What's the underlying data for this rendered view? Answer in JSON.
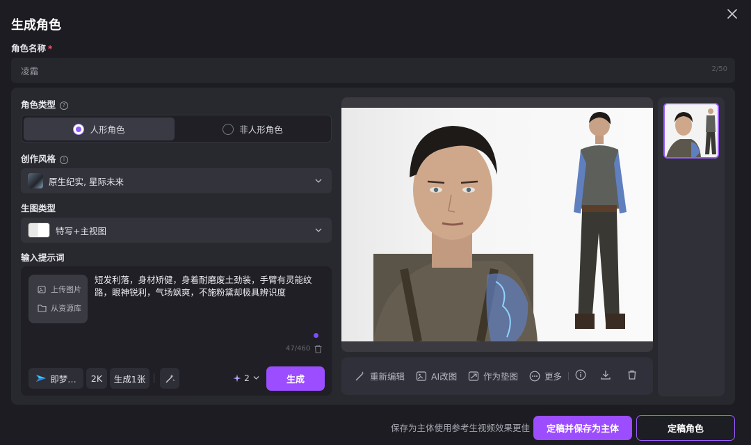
{
  "dialog": {
    "title": "生成角色",
    "close_icon": "close-icon"
  },
  "name_field": {
    "label": "角色名称",
    "required_mark": "*",
    "value": "凌霜",
    "counter": "2/50"
  },
  "character_type": {
    "label": "角色类型",
    "options": [
      {
        "label": "人形角色",
        "selected": true
      },
      {
        "label": "非人形角色",
        "selected": false
      }
    ]
  },
  "style": {
    "label": "创作风格",
    "value": "原生纪实, 星际未来"
  },
  "image_type": {
    "label": "生图类型",
    "value": "特写+主视图"
  },
  "prompt": {
    "label": "输入提示词",
    "upload_image": "上传图片",
    "from_library": "从资源库",
    "text": "短发利落，身材矫健，身着耐磨废土劲装，手臂有灵能纹路，眼神锐利，气场飒爽，不施粉黛却极具辨识度",
    "counter": "47/460"
  },
  "toolbar": {
    "model": "即梦…",
    "resolution": "2K",
    "count": "生成1张",
    "credits": "2",
    "generate": "生成"
  },
  "image_actions": {
    "reedit": "重新编辑",
    "ai_edit": "AI改图",
    "as_base": "作为垫图",
    "more": "更多"
  },
  "footer": {
    "hint": "保存为主体使用参考生视频效果更佳",
    "save_subject": "定稿并保存为主体",
    "finalize": "定稿角色"
  },
  "colors": {
    "accent": "#9b4dff",
    "background": "#1c1c22",
    "panel": "#28282f"
  }
}
